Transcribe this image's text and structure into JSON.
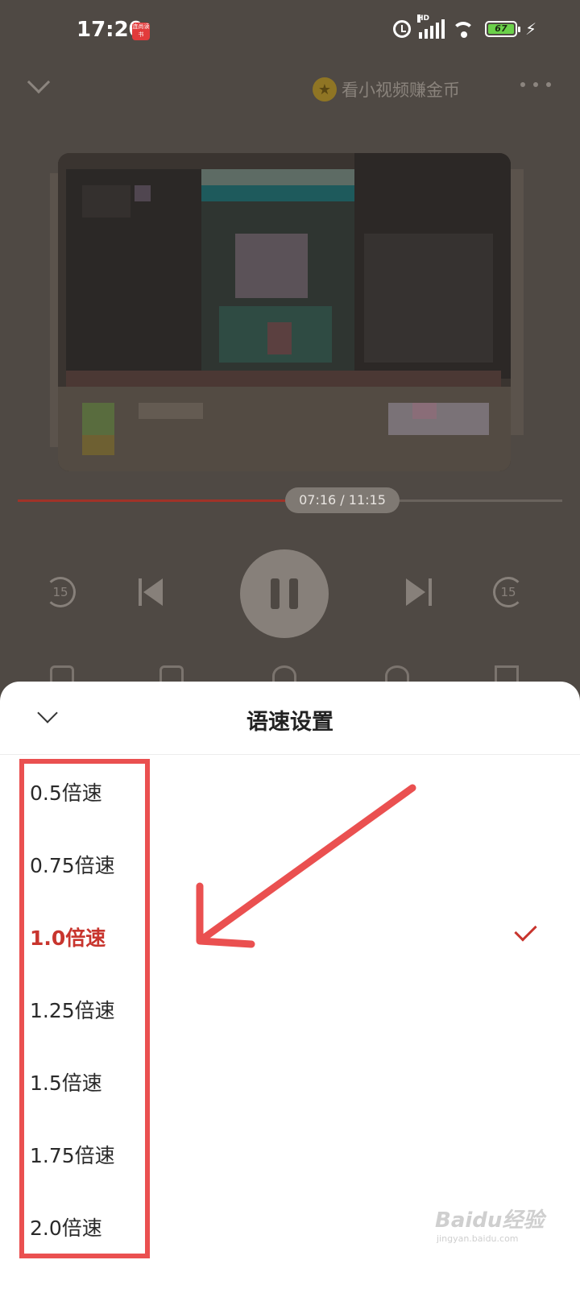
{
  "status_bar": {
    "time": "17:20",
    "app_badge": "连尚读书",
    "network": "HD",
    "battery": "67"
  },
  "header": {
    "coin_banner": "看小视频赚金币"
  },
  "player": {
    "time_display": "07:16 / 11:15",
    "progress_fraction": 0.649,
    "rewind_seconds": "15",
    "forward_seconds": "15"
  },
  "speed_sheet": {
    "title": "语速设置",
    "options": [
      {
        "label": "0.5倍速",
        "selected": false
      },
      {
        "label": "0.75倍速",
        "selected": false
      },
      {
        "label": "1.0倍速",
        "selected": true
      },
      {
        "label": "1.25倍速",
        "selected": false
      },
      {
        "label": "1.5倍速",
        "selected": false
      },
      {
        "label": "1.75倍速",
        "selected": false
      },
      {
        "label": "2.0倍速",
        "selected": false
      }
    ]
  },
  "colors": {
    "accent": "#c8352e",
    "annotation": "#ea5050"
  },
  "watermark": {
    "logo": "Baidu经验",
    "url": "jingyan.baidu.com"
  }
}
